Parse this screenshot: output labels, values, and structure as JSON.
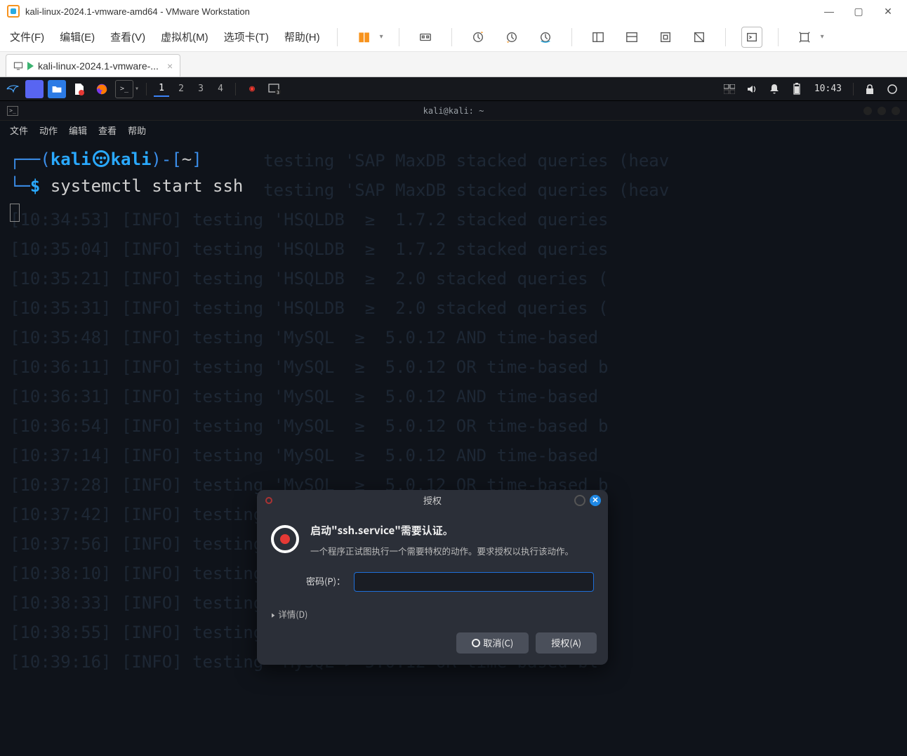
{
  "vmware": {
    "title": "kali-linux-2024.1-vmware-amd64 - VMware Workstation",
    "menu": {
      "file": "文件(F)",
      "edit": "编辑(E)",
      "view": "查看(V)",
      "vm": "虚拟机(M)",
      "tabs": "选项卡(T)",
      "help": "帮助(H)"
    },
    "tab_label": "kali-linux-2024.1-vmware-..."
  },
  "kali_taskbar": {
    "workspaces": [
      "1",
      "2",
      "3",
      "4"
    ],
    "active_workspace": 0,
    "clock": "10:43"
  },
  "terminal": {
    "window_title": "kali@kali: ~",
    "menu": {
      "file": "文件",
      "action": "动作",
      "edit": "编辑",
      "view": "查看",
      "help": "帮助"
    },
    "prompt": {
      "user": "kali",
      "host": "kali",
      "cwd": "~",
      "symbol": "$",
      "command": "systemctl start ssh"
    },
    "bg_log_lines": [
      "                         testing 'SAP MaxDB stacked queries (heav",
      "                         testing 'SAP MaxDB stacked queries (heav",
      "[10:34:53] [INFO] testing 'HSQLDB  ≥  1.7.2 stacked queries",
      "[10:35:04] [INFO] testing 'HSQLDB  ≥  1.7.2 stacked queries",
      "[10:35:21] [INFO] testing 'HSQLDB  ≥  2.0 stacked queries (",
      "[10:35:31] [INFO] testing 'HSQLDB  ≥  2.0 stacked queries (",
      "[10:35:48] [INFO] testing 'MySQL  ≥  5.0.12 AND time-based ",
      "[10:36:11] [INFO] testing 'MySQL  ≥  5.0.12 OR time-based b",
      "[10:36:31] [INFO] testing 'MySQL  ≥  5.0.12 AND time-based ",
      "[10:36:54] [INFO] testing 'MySQL  ≥  5.0.12 OR time-based b",
      "[10:37:14] [INFO] testing 'MySQL  ≥  5.0.12 AND time-based ",
      "[10:37:28] [INFO] testing 'MySQL  ≥  5.0.12 OR time-based b",
      "[10:37:42] [INFO] testing 'MySQL  ≥  5.0.12 AND time-based ",
      "[10:37:56] [INFO] testing 'MySQL  ≥  5.0.12 OR time-based b",
      "[10:38:10] [INFO] testing 'MySQL < 5.0.12 AND time-based b",
      "[10:38:33] [INFO] testing 'MySQL > 5.0.12 AND time-based b",
      "[10:38:55] [INFO] testing 'MySQL < 5.0.12 OR time-based bl",
      "[10:39:16] [INFO] testing 'MySQL > 5.0.12 OR time-based bl"
    ]
  },
  "auth_dialog": {
    "title": "授权",
    "heading": "启动\"ssh.service\"需要认证。",
    "body": "一个程序正试图执行一个需要特权的动作。要求授权以执行该动作。",
    "password_label": "密码(P)：",
    "password_value": "",
    "details_label": "详情(D)",
    "cancel_label": "取消(C)",
    "authorize_label": "授权(A)"
  }
}
